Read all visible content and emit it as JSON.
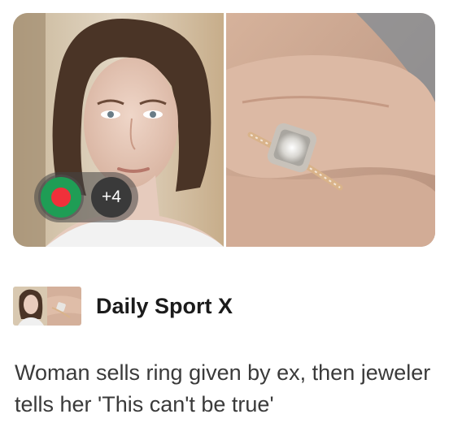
{
  "card": {
    "badge": {
      "flag_icon": "bangladesh-flag-icon",
      "more_count": "+4",
      "colors": {
        "green": "#1f9d55",
        "red": "#f0303a"
      }
    },
    "publisher": {
      "name": "Daily Sport X"
    },
    "headline": "Woman sells ring given by ex, then jeweler tells her 'This can't be true'"
  }
}
